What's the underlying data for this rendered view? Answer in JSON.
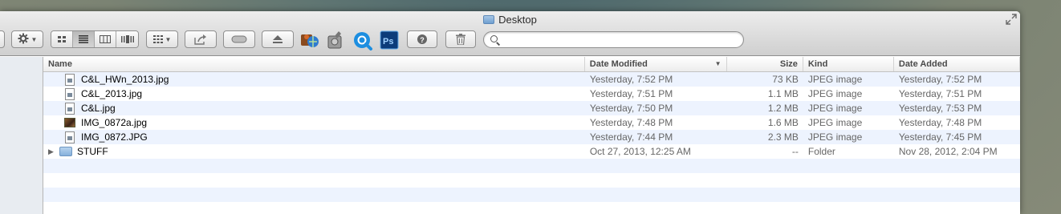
{
  "window": {
    "title": "Desktop"
  },
  "search": {
    "value": "",
    "placeholder": ""
  },
  "columns": {
    "name": "Name",
    "date_modified": "Date Modified",
    "size": "Size",
    "kind": "Kind",
    "date_added": "Date Added"
  },
  "files": [
    {
      "name": "C&L_HWn_2013.jpg",
      "date_modified": "Yesterday, 7:52 PM",
      "size": "73 KB",
      "kind": "JPEG image",
      "date_added": "Yesterday, 7:52 PM",
      "icon": "jpeg-doc-icon"
    },
    {
      "name": "C&L_2013.jpg",
      "date_modified": "Yesterday, 7:51 PM",
      "size": "1.1 MB",
      "kind": "JPEG image",
      "date_added": "Yesterday, 7:51 PM",
      "icon": "jpeg-doc-icon"
    },
    {
      "name": "C&L.jpg",
      "date_modified": "Yesterday, 7:50 PM",
      "size": "1.2 MB",
      "kind": "JPEG image",
      "date_added": "Yesterday, 7:53 PM",
      "icon": "jpeg-doc-icon"
    },
    {
      "name": "IMG_0872a.jpg",
      "date_modified": "Yesterday, 7:48 PM",
      "size": "1.6 MB",
      "kind": "JPEG image",
      "date_added": "Yesterday, 7:48 PM",
      "icon": "photo-thumbnail-icon"
    },
    {
      "name": "IMG_0872.JPG",
      "date_modified": "Yesterday, 7:44 PM",
      "size": "2.3 MB",
      "kind": "JPEG image",
      "date_added": "Yesterday, 7:45 PM",
      "icon": "jpeg-doc-icon"
    },
    {
      "name": "STUFF",
      "date_modified": "Oct 27, 2013, 12:25 AM",
      "size": "--",
      "kind": "Folder",
      "date_added": "Nov 28, 2012, 2:04 PM",
      "icon": "folder-icon"
    }
  ],
  "colors": {
    "row_stripe": "#edf3fe",
    "toolbar_top": "#ededed",
    "toolbar_bottom": "#cfcfcf"
  }
}
